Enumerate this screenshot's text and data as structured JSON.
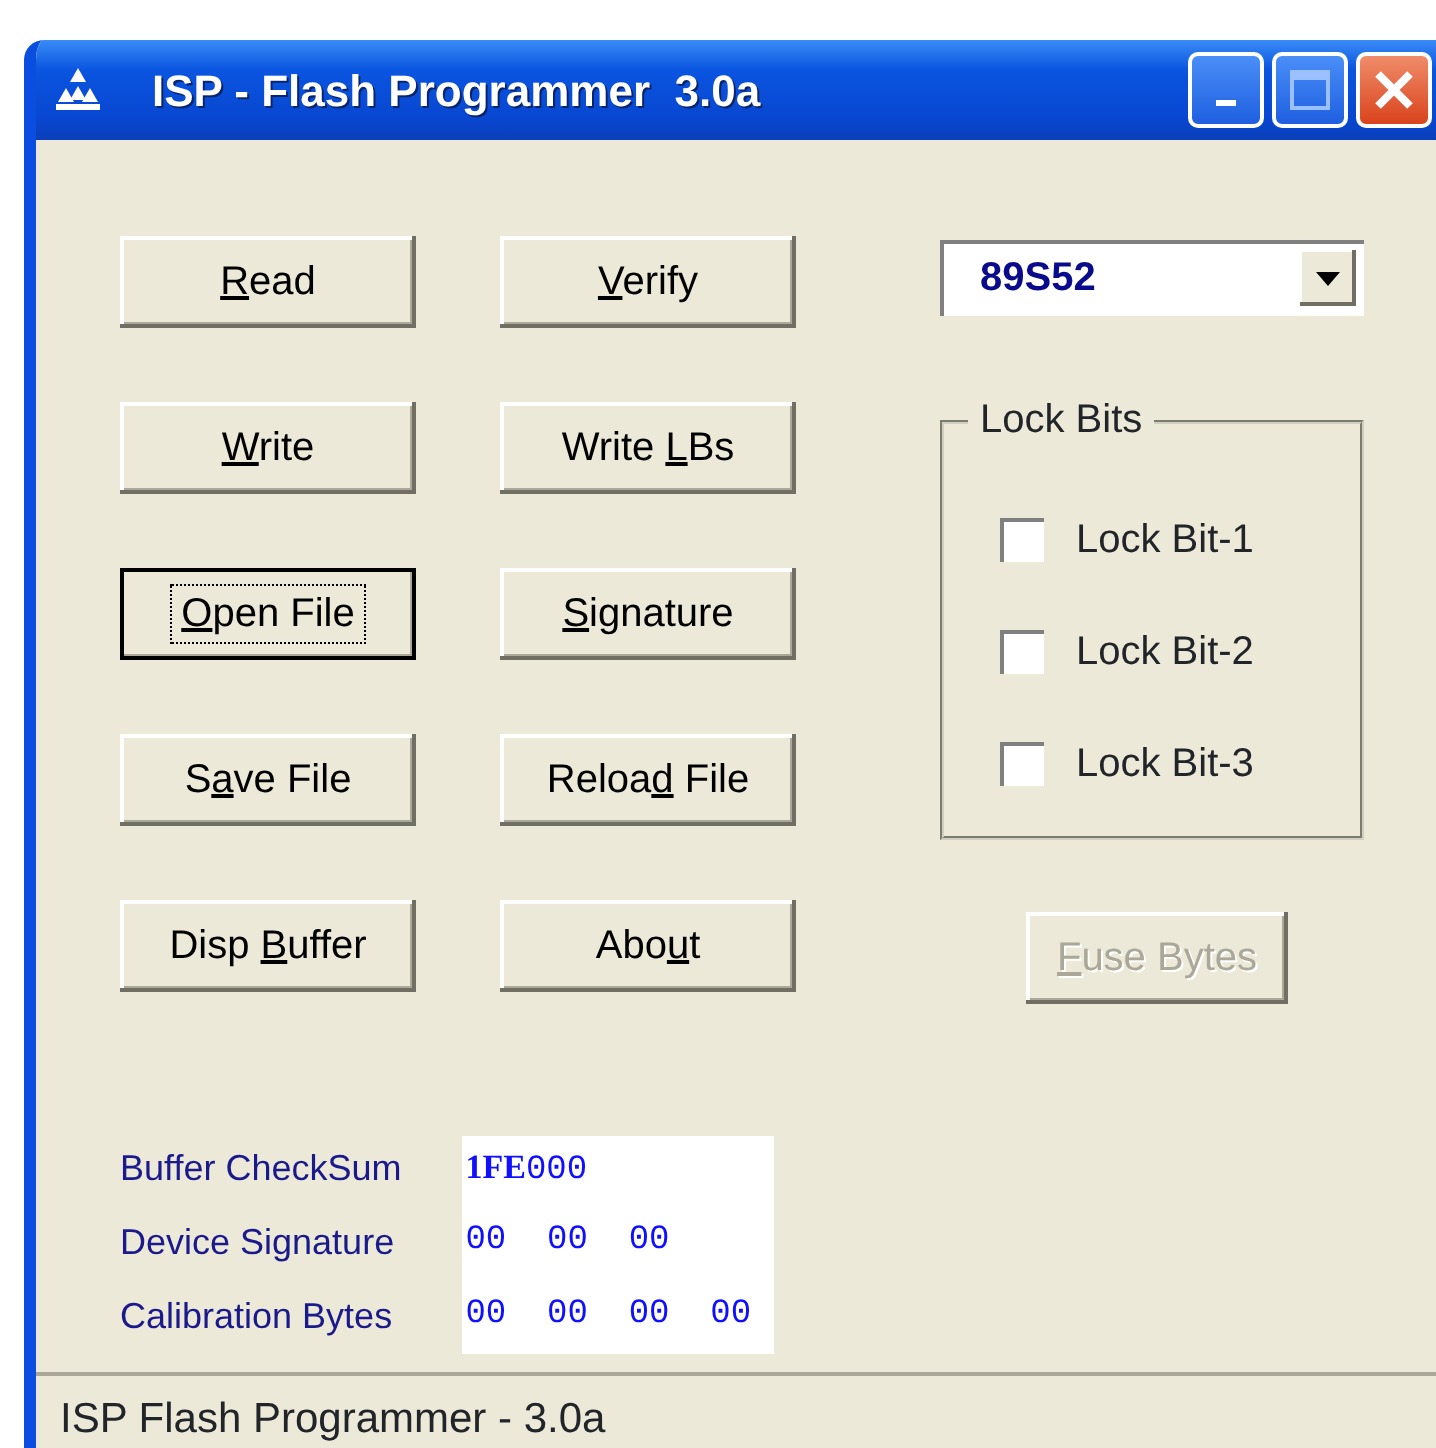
{
  "window": {
    "title": "ISP - Flash Programmer  3.0a"
  },
  "buttons": [
    {
      "key": "R",
      "after": "ead",
      "focused": false,
      "disabled": false
    },
    {
      "key": "V",
      "after": "erify",
      "focused": false,
      "disabled": false
    },
    {
      "key": "W",
      "after": "rite",
      "focused": false,
      "disabled": false
    },
    {
      "before": "Write ",
      "key": "L",
      "after": "Bs",
      "focused": false,
      "disabled": false
    },
    {
      "key": "O",
      "after": "pen File",
      "focused": true,
      "disabled": false
    },
    {
      "key": "S",
      "after": "ignature",
      "focused": false,
      "disabled": false
    },
    {
      "before": "S",
      "key": "a",
      "after": "ve File",
      "focused": false,
      "disabled": false
    },
    {
      "before": "Reloa",
      "key": "d",
      "after": " File",
      "focused": false,
      "disabled": false
    },
    {
      "before": "Disp ",
      "key": "B",
      "after": "uffer",
      "focused": false,
      "disabled": false
    },
    {
      "before": "Abo",
      "key": "u",
      "after": "t",
      "focused": false,
      "disabled": false
    }
  ],
  "device_select": {
    "value": "89S52"
  },
  "lock_bits": {
    "title": "Lock Bits",
    "items": [
      {
        "label": "Lock Bit-1",
        "checked": false
      },
      {
        "label": "Lock Bit-2",
        "checked": false
      },
      {
        "label": "Lock Bit-3",
        "checked": false
      }
    ]
  },
  "fuse_button": {
    "key": "F",
    "after": "use Bytes",
    "focused": false,
    "disabled": true
  },
  "info": [
    {
      "label": "Buffer CheckSum",
      "value": "**1FE**000"
    },
    {
      "label": "Device Signature",
      "value": "00  00  00"
    },
    {
      "label": "Calibration Bytes",
      "value": "00  00  00  00"
    }
  ],
  "status_bar": {
    "text": "ISP Flash Programmer - 3.0a"
  }
}
